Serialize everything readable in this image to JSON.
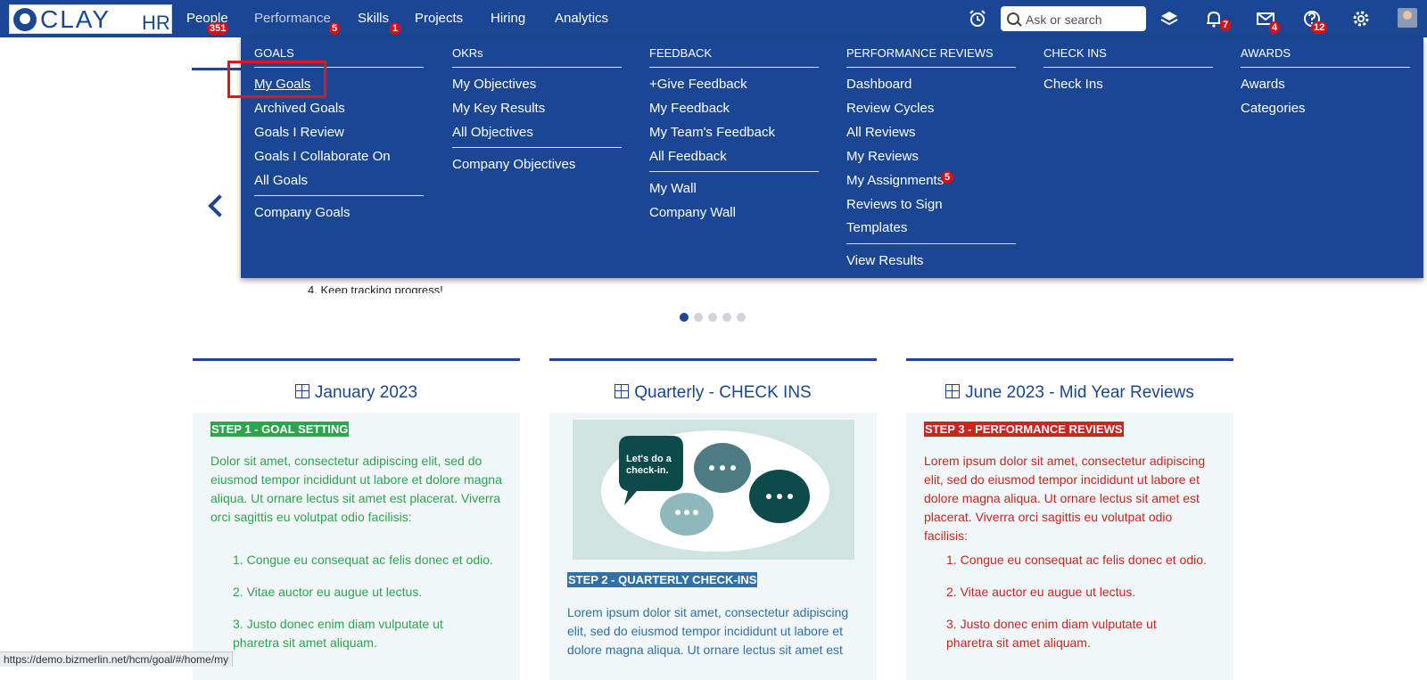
{
  "brand": {
    "logo_text": "CLAY",
    "logo_suffix": "HR"
  },
  "nav": {
    "items": [
      {
        "label": "People",
        "badge": "351"
      },
      {
        "label": "Performance",
        "badge": "5"
      },
      {
        "label": "Skills",
        "badge": "1"
      },
      {
        "label": "Projects"
      },
      {
        "label": "Hiring"
      },
      {
        "label": "Analytics"
      }
    ]
  },
  "header": {
    "search_placeholder": "Ask or search",
    "notifications_badge": "7",
    "messages_badge": "4",
    "help_badge": "12"
  },
  "menu": {
    "goals": {
      "title": "GOALS",
      "items": [
        "My Goals",
        "Archived Goals",
        "Goals I Review",
        "Goals I Collaborate On",
        "All Goals"
      ],
      "extra": [
        "Company Goals"
      ]
    },
    "okrs": {
      "title": "OKRs",
      "items": [
        "My Objectives",
        "My Key Results",
        "All Objectives"
      ],
      "extra": [
        "Company Objectives"
      ]
    },
    "feedback": {
      "title": "FEEDBACK",
      "items": [
        "+Give Feedback",
        "My Feedback",
        "My Team's Feedback",
        "All Feedback"
      ],
      "extra": [
        "My Wall",
        "Company Wall"
      ]
    },
    "reviews": {
      "title": "PERFORMANCE REVIEWS",
      "items": [
        "Dashboard",
        "Review Cycles",
        "All Reviews",
        "My Reviews",
        "My Assignments",
        "Reviews to Sign",
        "Templates"
      ],
      "assignments_badge": "5",
      "extra": [
        "View Results"
      ]
    },
    "checkins": {
      "title": "CHECK INS",
      "items": [
        "Check Ins"
      ]
    },
    "awards": {
      "title": "AWARDS",
      "items": [
        "Awards",
        "Categories"
      ]
    }
  },
  "carousel": {
    "peek_text": "4. Keep tracking progress!"
  },
  "cards": [
    {
      "title": "January 2023",
      "step": "STEP 1 - GOAL SETTING",
      "paragraph": "Dolor sit amet, consectetur adipiscing elit, sed do eiusmod tempor incididunt ut labore et dolore magna aliqua. Ut ornare lectus sit amet est placerat. Viverra orci sagittis eu volutpat odio facilisis:",
      "list": [
        "Congue eu consequat ac felis donec et odio.",
        "Vitae auctor eu augue ut lectus.",
        "Justo donec enim diam vulputate ut pharetra sit amet aliquam."
      ]
    },
    {
      "title": "Quarterly - CHECK INS",
      "image_caption": "Let's do a check-in.",
      "step": "STEP 2 - QUARTERLY CHECK-INS",
      "paragraph": "Lorem ipsum dolor sit amet, consectetur adipiscing elit, sed do eiusmod tempor incididunt ut labore et dolore magna aliqua. Ut ornare lectus sit amet est"
    },
    {
      "title": "June 2023 - Mid Year Reviews",
      "step": "STEP 3 - PERFORMANCE REVIEWS",
      "paragraph": "Lorem ipsum dolor sit amet, consectetur adipiscing elit, sed do eiusmod tempor incididunt ut labore et dolore magna aliqua. Ut ornare lectus sit amet est placerat. Viverra orci sagittis eu volutpat odio facilisis:",
      "list": [
        "Congue eu consequat ac felis donec et odio.",
        "Vitae auctor eu augue ut lectus.",
        "Justo donec enim diam vulputate ut pharetra sit amet aliquam."
      ]
    }
  ],
  "status_url": "https://demo.bizmerlin.net/hcm/goal/#/home/my",
  "colors": {
    "primary": "#1a4693",
    "badge": "#d6101a",
    "highlight": "#e3141c",
    "step1": "#2da44e",
    "step2": "#2f71a8",
    "step3": "#c8261f"
  }
}
